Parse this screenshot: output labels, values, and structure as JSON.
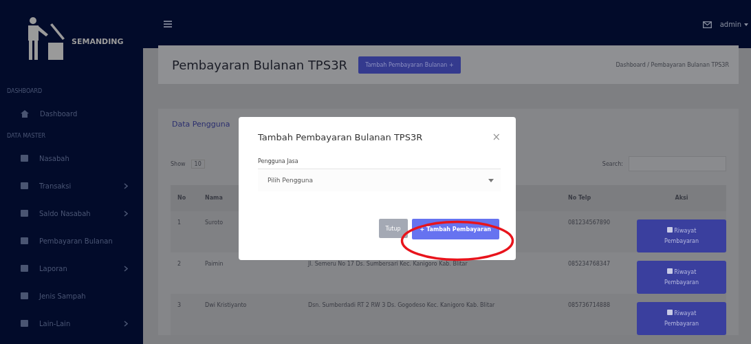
{
  "sidebar": {
    "brand": "SEMANDING",
    "sections": [
      {
        "heading": "DASHBOARD",
        "items": [
          {
            "label": "Dashboard",
            "has_submenu": false
          }
        ]
      },
      {
        "heading": "DATA MASTER",
        "items": [
          {
            "label": "Nasabah",
            "has_submenu": false
          },
          {
            "label": "Transaksi",
            "has_submenu": true
          },
          {
            "label": "Saldo Nasabah",
            "has_submenu": true
          },
          {
            "label": "Pembayaran Bulanan",
            "has_submenu": false
          },
          {
            "label": "Laporan",
            "has_submenu": true
          },
          {
            "label": "Jenis Sampah",
            "has_submenu": false
          },
          {
            "label": "Lain-Lain",
            "has_submenu": true
          }
        ]
      }
    ]
  },
  "topbar": {
    "user": "admin"
  },
  "page": {
    "title": "Pembayaran Bulanan TPS3R",
    "add_button": "Tambah Pembayaran Bulanan +",
    "breadcrumb": "Dashboard / Pembayaran Bulanan TPS3R"
  },
  "card": {
    "title": "Data Pengguna",
    "show_label": "Show",
    "page_size": "10",
    "search_label": "Search:"
  },
  "table": {
    "columns": [
      "No",
      "Nama",
      "No Telp",
      "Aksi"
    ],
    "rows": [
      {
        "no": "1",
        "name": "Suroto",
        "phone": "081234567890",
        "action": "Riwayat Pembayaran"
      },
      {
        "no": "2",
        "name": "Paimin",
        "address": "Jl. Semeru No 17 Ds. Sumbersari Kec. Kanigoro Kab. Blitar",
        "phone": "085234768347",
        "action": "Riwayat Pembayaran"
      },
      {
        "no": "3",
        "name": "Dwi Kristiyanto",
        "address": "Dsn. Sumberdadi RT 2 RW 3 Ds. Gogodeso Kec. Kanigoro Kab. Blitar",
        "phone": "085736714888",
        "action": "Riwayat Pembayaran"
      }
    ]
  },
  "modal": {
    "title": "Tambah Pembayaran Bulanan TPS3R",
    "close": "×",
    "field_label": "Pengguna Jasa",
    "placeholder": "Pilih Pengguna",
    "cancel_button": "Tutup",
    "submit_button": "+ Tambah Pembayaran",
    "submit_highlighted": true
  }
}
